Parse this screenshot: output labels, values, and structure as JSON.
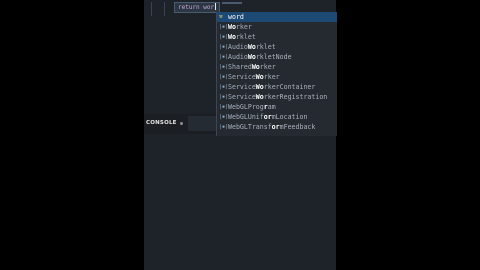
{
  "editor": {
    "snippet_text": "return wor",
    "background": "#1e2329"
  },
  "panel": {
    "tab_label": "CONSOLE"
  },
  "suggestions": {
    "items": [
      {
        "icon": "key-icon",
        "prefix": "",
        "match": "",
        "text": "word",
        "selected": true
      },
      {
        "icon": "class-icon",
        "prefix": "",
        "match": "Wo",
        "text": "rker",
        "selected": false
      },
      {
        "icon": "class-icon",
        "prefix": "",
        "match": "Wo",
        "text": "rklet",
        "selected": false
      },
      {
        "icon": "class-icon",
        "prefix": "Audio",
        "match": "Wo",
        "text": "rklet",
        "selected": false
      },
      {
        "icon": "class-icon",
        "prefix": "Audio",
        "match": "Wo",
        "text": "rkletNode",
        "selected": false
      },
      {
        "icon": "class-icon",
        "prefix": "Shared",
        "match": "Wo",
        "text": "rker",
        "selected": false
      },
      {
        "icon": "class-icon",
        "prefix": "Service",
        "match": "Wo",
        "text": "rker",
        "selected": false
      },
      {
        "icon": "class-icon",
        "prefix": "Service",
        "match": "Wo",
        "text": "rkerContainer",
        "selected": false
      },
      {
        "icon": "class-icon",
        "prefix": "Service",
        "match": "Wo",
        "text": "rkerRegistration",
        "selected": false
      },
      {
        "icon": "class-icon",
        "prefix": "WebGLProg",
        "match": "r",
        "text": "am",
        "selected": false
      },
      {
        "icon": "class-icon",
        "prefix": "WebGLUnif",
        "match": "or",
        "text": "mLocation",
        "selected": false
      },
      {
        "icon": "class-icon",
        "prefix": "WebGLTransf",
        "match": "or",
        "text": "mFeedback",
        "selected": false
      }
    ]
  },
  "colors": {
    "selection": "#1c4a74",
    "match_highlight": "#ffffff"
  }
}
